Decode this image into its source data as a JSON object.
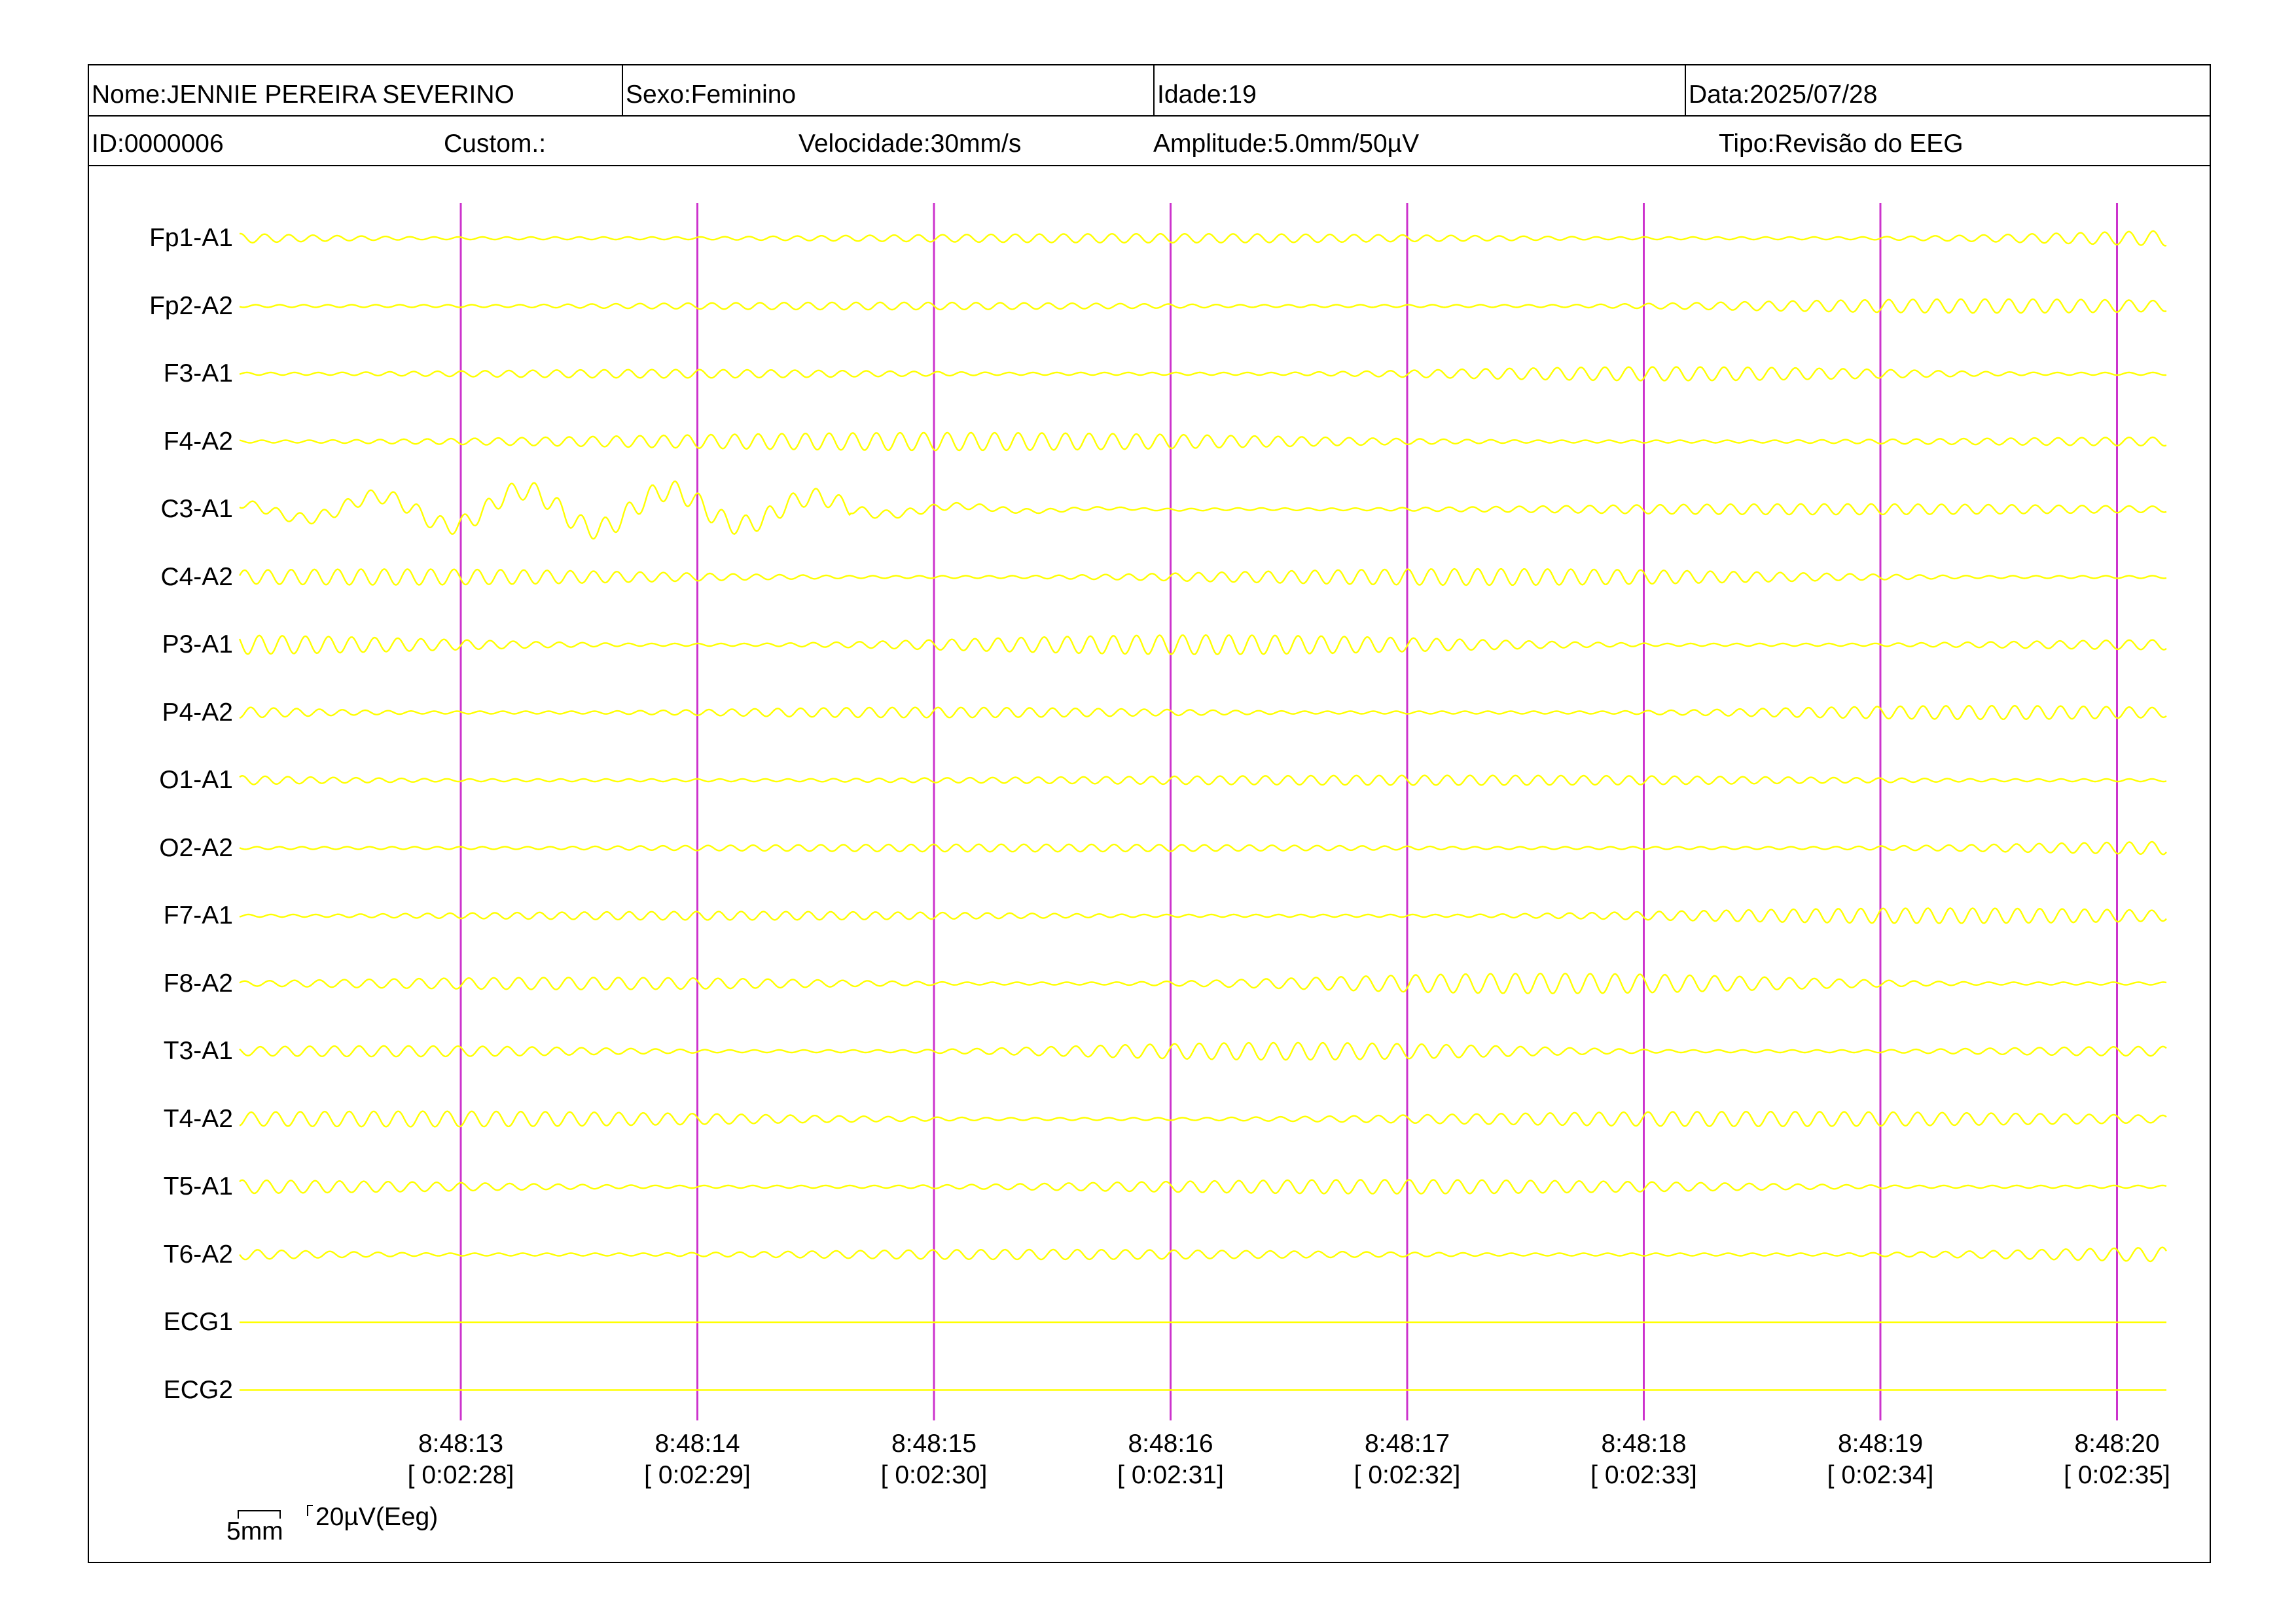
{
  "header": {
    "name": "Nome:JENNIE PEREIRA SEVERINO",
    "sex": "Sexo:Feminino",
    "age": "Idade:19",
    "date": "Data:2025/07/28",
    "id": "ID:0000006",
    "custom": "Custom.:",
    "speed": "Velocidade:30mm/s",
    "amplitude": "Amplitude:5.0mm/50µV",
    "type": "Tipo:Revisão do EEG"
  },
  "channels": [
    {
      "label": "Fp1-A1",
      "type": "eeg"
    },
    {
      "label": "Fp2-A2",
      "type": "eeg"
    },
    {
      "label": "F3-A1",
      "type": "eeg"
    },
    {
      "label": "F4-A2",
      "type": "eeg"
    },
    {
      "label": "C3-A1",
      "type": "eeg"
    },
    {
      "label": "C4-A2",
      "type": "eeg"
    },
    {
      "label": "P3-A1",
      "type": "eeg"
    },
    {
      "label": "P4-A2",
      "type": "eeg"
    },
    {
      "label": "O1-A1",
      "type": "eeg"
    },
    {
      "label": "O2-A2",
      "type": "eeg"
    },
    {
      "label": "F7-A1",
      "type": "eeg"
    },
    {
      "label": "F8-A2",
      "type": "eeg"
    },
    {
      "label": "T3-A1",
      "type": "eeg"
    },
    {
      "label": "T4-A2",
      "type": "eeg"
    },
    {
      "label": "T5-A1",
      "type": "eeg"
    },
    {
      "label": "T6-A2",
      "type": "eeg"
    },
    {
      "label": "ECG1",
      "type": "flat"
    },
    {
      "label": "ECG2",
      "type": "flat"
    }
  ],
  "time_marks": [
    {
      "clock": "8:48:13",
      "elapsed": "[ 0:02:28]"
    },
    {
      "clock": "8:48:14",
      "elapsed": "[ 0:02:29]"
    },
    {
      "clock": "8:48:15",
      "elapsed": "[ 0:02:30]"
    },
    {
      "clock": "8:48:16",
      "elapsed": "[ 0:02:31]"
    },
    {
      "clock": "8:48:17",
      "elapsed": "[ 0:02:32]"
    },
    {
      "clock": "8:48:18",
      "elapsed": "[ 0:02:33]"
    },
    {
      "clock": "8:48:19",
      "elapsed": "[ 0:02:34]"
    },
    {
      "clock": "8:48:20",
      "elapsed": "[ 0:02:35]"
    }
  ],
  "scale": {
    "time_label": "5mm",
    "amplitude_label": "20µV(Eeg)"
  },
  "colors": {
    "trace": "#ffff00",
    "second_marker": "#cc33cc",
    "border": "#000000",
    "background": "#ffffff"
  }
}
